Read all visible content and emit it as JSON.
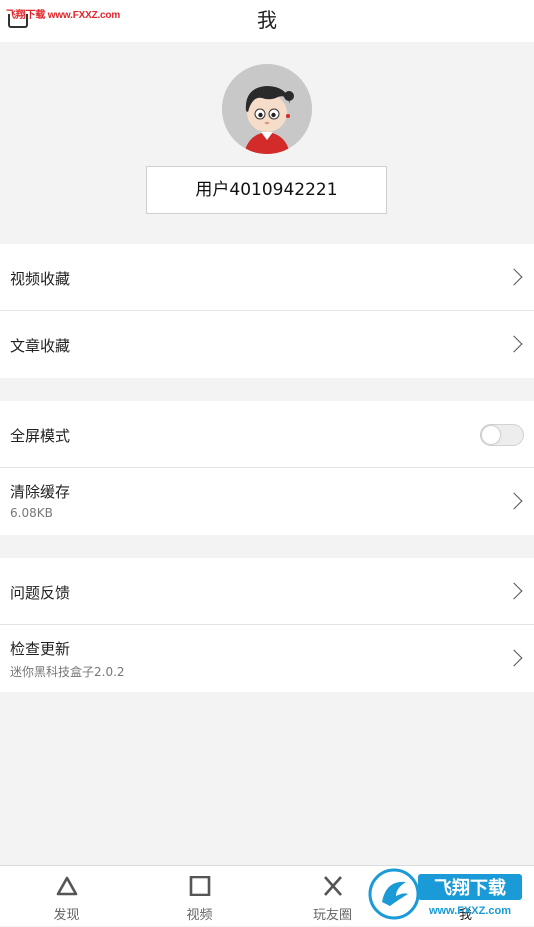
{
  "watermark_top": "飞翔下载 www.FXXZ.com",
  "header": {
    "title": "我"
  },
  "profile": {
    "username": "用户4010942221"
  },
  "sections": {
    "favorites": [
      {
        "label": "视频收藏"
      },
      {
        "label": "文章收藏"
      }
    ],
    "settings": {
      "fullscreen": {
        "label": "全屏模式",
        "enabled": false
      },
      "clear_cache": {
        "label": "清除缓存",
        "sub": "6.08KB"
      }
    },
    "about": {
      "feedback": {
        "label": "问题反馈"
      },
      "update": {
        "label": "检查更新",
        "sub": "迷你黑科技盒子2.0.2"
      }
    }
  },
  "tabbar": {
    "items": [
      {
        "label": "发现",
        "icon": "triangle-icon"
      },
      {
        "label": "视频",
        "icon": "square-icon"
      },
      {
        "label": "玩友圈",
        "icon": "cross-icon"
      },
      {
        "label": "我",
        "icon": "circle-icon",
        "active": true
      }
    ]
  },
  "watermark_badge": {
    "text": "飞翔下载",
    "url": "www.FXXZ.com"
  },
  "colors": {
    "watermark": "#e0262b",
    "badge": "#1a9ad6"
  }
}
